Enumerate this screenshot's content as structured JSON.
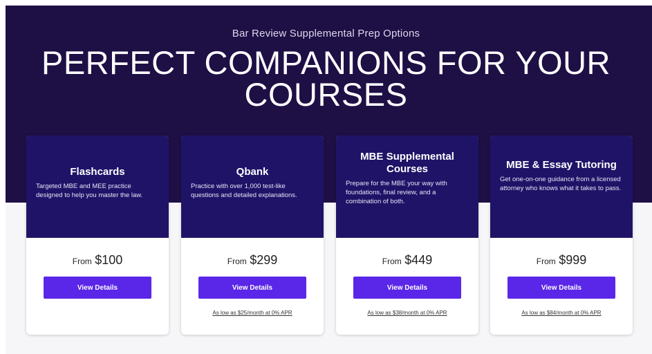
{
  "hero": {
    "eyebrow": "Bar Review Supplemental Prep Options",
    "headline": "PERFECT COMPANIONS FOR YOUR COURSES"
  },
  "cards": [
    {
      "title": "Flashcards",
      "description": "Targeted MBE and MEE practice designed to help you master the law.",
      "price_from": "From",
      "price": "$100",
      "button_label": "View Details",
      "finance": ""
    },
    {
      "title": "Qbank",
      "description": "Practice with over 1,000 test-like questions and detailed explanations.",
      "price_from": "From",
      "price": "$299",
      "button_label": "View Details",
      "finance": "As low as $25/month at 0% APR"
    },
    {
      "title": "MBE Supplemental Courses",
      "description": "Prepare for the MBE your way with foundations, final review, and a combination of both.",
      "price_from": "From",
      "price": "$449",
      "button_label": "View Details",
      "finance": "As low as $38/month at 0% APR"
    },
    {
      "title": "MBE & Essay Tutoring",
      "description": "Get one-on-one guidance from a licensed attorney who knows what it takes to pass.",
      "price_from": "From",
      "price": "$999",
      "button_label": "View Details",
      "finance": "As low as $84/month at 0% APR"
    }
  ],
  "colors": {
    "hero_bg": "#1e0f45",
    "card_top_bg": "#1f1368",
    "button_bg": "#5a26e8"
  }
}
